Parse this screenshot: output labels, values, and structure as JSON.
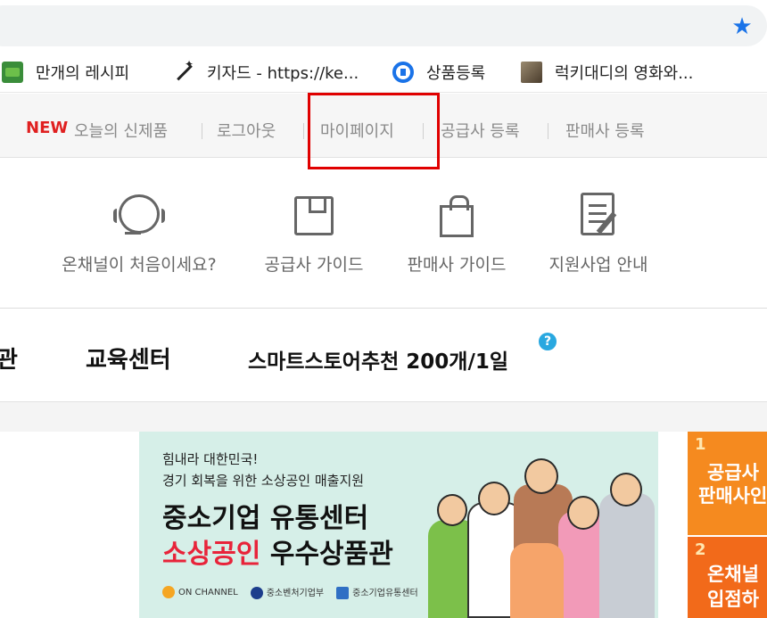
{
  "browser": {
    "bookmarks": [
      {
        "label": "만개의 레시피",
        "icon": "recipe-icon"
      },
      {
        "label": "키자드 - https://ke...",
        "icon": "magic-wand-icon"
      },
      {
        "label": "상품등록",
        "icon": "blue-logo-icon"
      },
      {
        "label": "럭키대디의 영화와...",
        "icon": "photo-thumbnail-icon"
      }
    ],
    "star_color": "#1a73e8"
  },
  "util_nav": {
    "new_badge": "NEW",
    "items": [
      "오늘의 신제품",
      "로그아웃",
      "마이페이지",
      "공급사 등록",
      "판매사 등록"
    ],
    "highlighted": "마이페이지",
    "highlight_color": "#e00000"
  },
  "guides": [
    {
      "label": "온채널이 처음이세요?",
      "icon": "headset-icon"
    },
    {
      "label": "공급사 가이드",
      "icon": "box-icon"
    },
    {
      "label": "판매사 가이드",
      "icon": "shopping-bag-icon"
    },
    {
      "label": "지원사업 안내",
      "icon": "document-edit-icon"
    }
  ],
  "main_nav": {
    "items": [
      "관",
      "교육센터",
      "스마트스토어추천 200개/1일"
    ],
    "help": "?"
  },
  "banner": {
    "line1": "힘내라 대한민국!",
    "line2": "경기 회복을 위한 소상공인 매출지원",
    "title": "중소기업 유통센터",
    "title2_red": "소상공인",
    "title2_black": "우수상품관",
    "logos": [
      "ON CHANNEL",
      "중소벤처기업부",
      "중소기업유통센터"
    ]
  },
  "side_banners": [
    {
      "num": "1",
      "lines": [
        "공급사",
        "판매사인"
      ]
    },
    {
      "num": "2",
      "lines": [
        "온채널",
        "입점하"
      ]
    }
  ]
}
